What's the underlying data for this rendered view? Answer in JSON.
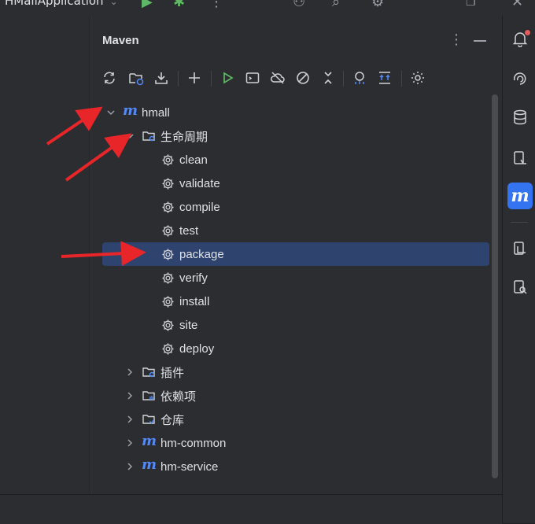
{
  "topbar": {
    "run_config": "HMallApplication"
  },
  "maven": {
    "title": "Maven",
    "toolbar": [
      {
        "name": "reload-all-icon"
      },
      {
        "name": "reload-folder-icon"
      },
      {
        "name": "download-icon"
      },
      {
        "name": "add-icon"
      },
      {
        "name": "run-icon"
      },
      {
        "name": "execute-goal-icon"
      },
      {
        "name": "offline-mode-icon"
      },
      {
        "name": "skip-tests-icon"
      },
      {
        "name": "collapse-all-icon"
      },
      {
        "name": "analyze-dependencies-icon"
      },
      {
        "name": "show-dependencies-icon"
      },
      {
        "name": "settings-icon"
      }
    ],
    "tree": {
      "root": "hmall",
      "lifecycle": "生命周期",
      "goals": [
        "clean",
        "validate",
        "compile",
        "test",
        "package",
        "verify",
        "install",
        "site",
        "deploy"
      ],
      "selected_goal": "package",
      "plugins": "插件",
      "dependencies": "依赖项",
      "repositories": "仓库",
      "modules": [
        "hm-common",
        "hm-service"
      ]
    }
  },
  "colors": {
    "accent": "#3574f0",
    "selection": "#2e436e",
    "maven_blue": "#548af7",
    "annotation_red": "#e8262a",
    "run_green": "#5fb865"
  },
  "right_strip": [
    {
      "name": "notifications-icon"
    },
    {
      "name": "ai-assistant-icon"
    },
    {
      "name": "database-icon"
    },
    {
      "name": "endpoints-icon"
    },
    {
      "name": "maven-icon",
      "active": true
    },
    {
      "name": "clipboard-icon"
    },
    {
      "name": "inspect-icon"
    }
  ]
}
